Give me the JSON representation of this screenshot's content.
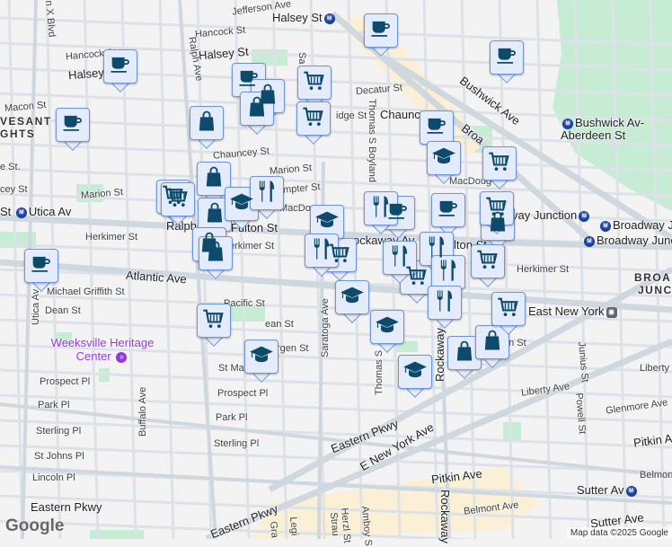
{
  "map": {
    "attribution": "Map data ©2025 Google",
    "logo": "Google",
    "streets": {
      "jefferson": "Jefferson Ave",
      "halsey_st_station": "Halsey St",
      "hancock1": "Hancock St",
      "hancock2": "Hancock St",
      "halsey1": "Halsey St",
      "halsey2": "Halsey St",
      "ralph_ave": "Ralph Ave",
      "malcolm_x": "n X Blvd",
      "decatur": "Decatur St",
      "macon": "Macon St",
      "chauncey": "Chauncey St",
      "chauncey_station": "Chaunc",
      "bainbridge": "idge St",
      "thomas_boyland": "Thomas S Boyland",
      "bushwick_ave": "Bushwick Ave",
      "bushwick_station": "Bushwick Av-Aberdeen St",
      "broadway": "Broa",
      "marion1": "Marion St",
      "marion2": "Marion St",
      "hampton": "mpter St",
      "macdougal1": "MacDo",
      "macdougal2": "MacDoug",
      "utica_station": "Utica Av",
      "ralph_station": "Ralph",
      "fulton": "Fulton St",
      "rockaway_station": "ockaway Av",
      "fulton2": "lton St",
      "broadway_junction": "vay Junction",
      "broadway_j1": "Broadway J",
      "broadway_j2": "Broadway Junc",
      "herkimer1": "Herkimer St",
      "herkimer2": "erkimer St",
      "herkimer3": "Herkimer St",
      "atlantic": "Atlantic Ave",
      "michael_griffith": "Michael Griffith St",
      "dean1": "Dean St",
      "dean2": "ean St",
      "dean3": "an St",
      "pacific": "Pacific St",
      "utica_ave": "Utica Av",
      "bergen": "rgen St",
      "saratoga": "Saratoga Ave",
      "saratoga_top": "Sa",
      "st_marks": "St Ma",
      "prospect1": "Prospect Pl",
      "prospect2": "Prospect Pl",
      "park1": "Park Pl",
      "park2": "Park Pl",
      "sterling1": "Sterling Pl",
      "sterling2": "Sterling Pl",
      "st_johns": "St Johns Pl",
      "lincoln": "Lincoln Pl",
      "eastern_pkwy1": "Eastern Pkwy",
      "eastern_pkwy2": "Eastern Pkwy",
      "eastern_pkwy3": "Eastern Pkwy",
      "buffalo": "Buffalo Ave",
      "thomas2": "Thomas S",
      "rockaway_ave": "Rockaway",
      "rockaway_ave2": "Rockaway",
      "east_new_york": "East New York",
      "liberty1": "Liberty Ave",
      "liberty2": "Liberty",
      "junius": "Junius St",
      "powell": "Powell St",
      "glenmore": "Glenmore Ave",
      "e_new_york_ave": "E New York Ave",
      "pitkin1": "Pitkin Ave",
      "pitkin2": "Pitkin A",
      "belmont1": "Belmont Ave",
      "belmont2": "Belmon",
      "sutter_station": "Sutter Av",
      "sutter_ave": "Sutter Ave",
      "herzl": "Herzl St",
      "amboy": "Amboy S",
      "strauss": "Strau",
      "legion": "Legi",
      "grafton": "Gra",
      "hood1": "VESANT",
      "hood2": "GHTS",
      "hood3": "BROA",
      "hood4": "JUNC",
      "st_short": "e St.",
      "cey": "cey St"
    },
    "poi": {
      "weeksville": "Weeksville Heritage Center"
    },
    "markers": [
      "coffee",
      "coffee",
      "coffee",
      "coffee",
      "coffee",
      "coffee",
      "coffee",
      "coffee",
      "coffee",
      "shopping",
      "shopping",
      "shopping",
      "shopping",
      "shopping",
      "shopping",
      "shopping",
      "shopping",
      "shopping",
      "shopping",
      "grocery",
      "grocery",
      "grocery",
      "grocery",
      "grocery",
      "grocery",
      "grocery",
      "grocery",
      "grocery",
      "grocery",
      "grocery",
      "school",
      "school",
      "school",
      "school",
      "school",
      "school",
      "school",
      "restaurant",
      "restaurant",
      "restaurant",
      "restaurant",
      "restaurant",
      "restaurant",
      "restaurant"
    ],
    "colors": {
      "marker_fill": "#e4ecfb",
      "icon": "#0d4a6b",
      "park": "#c6ecd4",
      "road": "#d5dce4",
      "commercial": "#fbf0d5"
    }
  }
}
